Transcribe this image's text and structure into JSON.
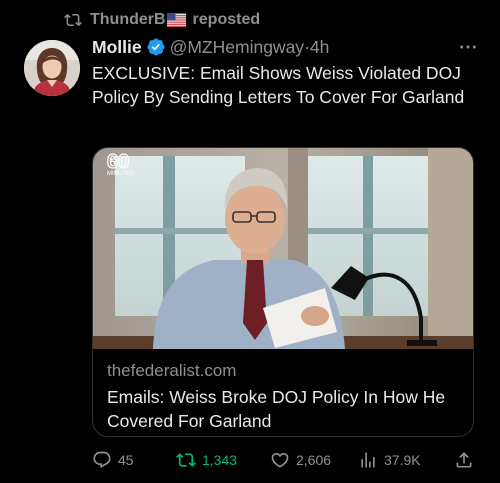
{
  "repost": {
    "user": "ThunderB",
    "label": "reposted"
  },
  "author": {
    "name": "Mollie",
    "handle": "@MZHemingway",
    "separator": "·",
    "time": "4h"
  },
  "tweet": {
    "text": "EXCLUSIVE: Email Shows Weiss Violated DOJ Policy By Sending Letters To Cover For Garland"
  },
  "card": {
    "watermark_number": "60",
    "watermark_word": "MINUTES",
    "domain": "thefederalist.com",
    "title": "Emails: Weiss Broke DOJ Policy In How He Covered For Garland"
  },
  "actions": {
    "replies": "45",
    "reposts": "1,343",
    "likes": "2,606",
    "views": "37.9K"
  },
  "colors": {
    "background": "#000000",
    "text": "#e7e9ea",
    "muted": "#8b9095",
    "verified": "#1d9bf0",
    "repost_active": "#00ba7c",
    "border": "#2f3336"
  },
  "icons": [
    "repost-icon",
    "flag-us-icon",
    "verified-badge-icon",
    "more-options-icon",
    "reply-icon",
    "repost-action-icon",
    "like-icon",
    "views-icon",
    "share-icon"
  ]
}
